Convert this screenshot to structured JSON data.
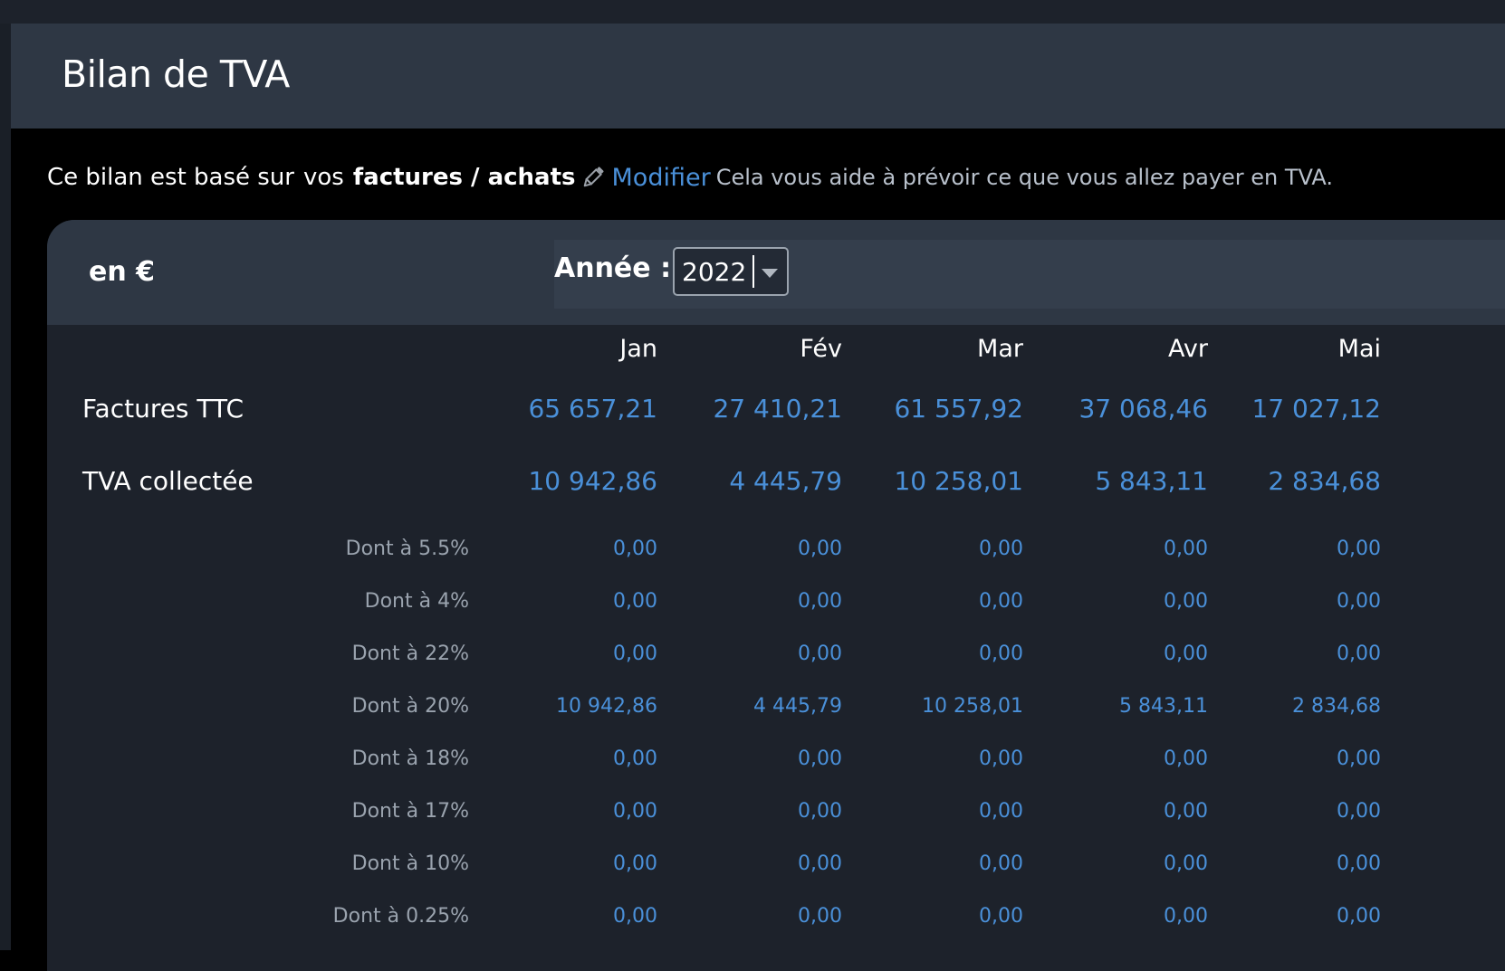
{
  "header": {
    "title": "Bilan de TVA"
  },
  "intro": {
    "prefix": "Ce bilan est basé sur",
    "vos": "vos",
    "source": "factures / achats",
    "modify_link": "Modifier",
    "hint": "Cela vous aide à prévoir ce que vous allez payer en TVA."
  },
  "table": {
    "currency_label": "en €",
    "year_label": "Année :",
    "year_value": "2022",
    "months": [
      "Jan",
      "Fév",
      "Mar",
      "Avr",
      "Mai"
    ],
    "main_rows": [
      {
        "label": "Factures TTC",
        "values": [
          "65 657,21",
          "27 410,21",
          "61 557,92",
          "37 068,46",
          "17 027,12"
        ]
      },
      {
        "label": "TVA collectée",
        "values": [
          "10 942,86",
          "4 445,79",
          "10 258,01",
          "5 843,11",
          "2 834,68"
        ]
      }
    ],
    "sub_rows": [
      {
        "label": "Dont à 5.5%",
        "values": [
          "0,00",
          "0,00",
          "0,00",
          "0,00",
          "0,00"
        ]
      },
      {
        "label": "Dont à 4%",
        "values": [
          "0,00",
          "0,00",
          "0,00",
          "0,00",
          "0,00"
        ]
      },
      {
        "label": "Dont à 22%",
        "values": [
          "0,00",
          "0,00",
          "0,00",
          "0,00",
          "0,00"
        ]
      },
      {
        "label": "Dont à 20%",
        "values": [
          "10 942,86",
          "4 445,79",
          "10 258,01",
          "5 843,11",
          "2 834,68"
        ]
      },
      {
        "label": "Dont à 18%",
        "values": [
          "0,00",
          "0,00",
          "0,00",
          "0,00",
          "0,00"
        ]
      },
      {
        "label": "Dont à 17%",
        "values": [
          "0,00",
          "0,00",
          "0,00",
          "0,00",
          "0,00"
        ]
      },
      {
        "label": "Dont à 10%",
        "values": [
          "0,00",
          "0,00",
          "0,00",
          "0,00",
          "0,00"
        ]
      },
      {
        "label": "Dont à 0.25%",
        "values": [
          "0,00",
          "0,00",
          "0,00",
          "0,00",
          "0,00"
        ]
      }
    ]
  }
}
